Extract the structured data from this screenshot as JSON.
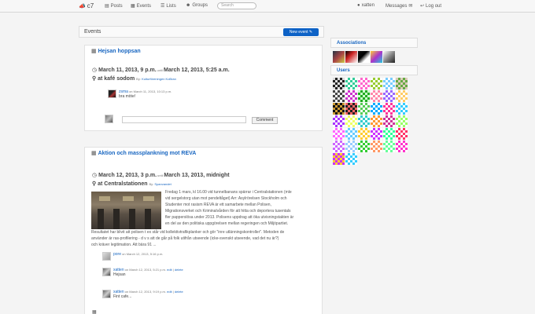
{
  "nav": {
    "brand": "c7",
    "items": [
      {
        "label": "Posts",
        "icon": "document-icon"
      },
      {
        "label": "Events",
        "icon": "calendar-icon"
      },
      {
        "label": "Lists",
        "icon": "list-icon"
      },
      {
        "label": "Groups",
        "icon": "group-icon"
      }
    ],
    "search_placeholder": "Search",
    "user": "xatten",
    "messages": "Messages",
    "logout": "Log out"
  },
  "page": {
    "title": "Events",
    "new_event_label": "New event"
  },
  "events": [
    {
      "title": "Hejsan hoppsan",
      "start": "March 11, 2013, 9 p.m.",
      "until": "until",
      "end": "March 12, 2013, 5:25 a.m.",
      "location": "at kafé sodom",
      "by_label": "By:",
      "by": "Kulturföreningen KoBran",
      "comments": [
        {
          "author": "zsma",
          "meta": "on March 11, 2013, 10:13 p.m.",
          "text": "bra möte!"
        }
      ],
      "comment_button": "Comment"
    },
    {
      "title": "Aktion och massplankning mot REVA",
      "start": "March 12, 2013, 3 p.m.",
      "until": "until",
      "end": "March 13, 2013, midnight",
      "location": "at Centralstationen",
      "by_label": "By:",
      "by": "Spanvandet",
      "description_lines": [
        "Fredag 1 mars, kl 16.00 vid tunnelbanans spärrar i Centralstationen (mle",
        "vid sergelstorg utan mot pendeltåget) Arr: Asylrörelsen Stockholm och",
        "Studenter mot rasism REVA är ett samarbete mellan Polisen,",
        "Migrationsverket och Kriminalvården för att hitta och deportera tusentals",
        "fler papperslösa under 2013. Polisens uppdrag att öka utvisningstakten är",
        "en del av den politiska uppgörelsen mellan regeringen och Miljöpartiet."
      ],
      "description_full_lines": [
        "Resultatet har blivit att polisen t ex står vid kollektivtrafikplanker och gör \"inre utlänningskontroller\". Metoden de",
        "använder är ras-profilering - d v s att de går på folk utifrån utseende (icke-svenskt utseende, vad det nu är?)",
        "och kräver legitimation. Att bära 91 ..."
      ],
      "comments": [
        {
          "author": "pore",
          "meta": "on March 12, 2013, 5:16 p.m.",
          "text": ""
        },
        {
          "author": "xatten",
          "meta": "on March 12, 2013, 5:21 p.m.",
          "edit": "edit",
          "delete": "delete",
          "text": "Hejsan"
        },
        {
          "author": "xatten",
          "meta": "on March 12, 2013, 9:19 p.m.",
          "edit": "edit",
          "delete": "delete",
          "text": "Fint cafe..."
        }
      ]
    }
  ],
  "sidebar": {
    "associations_title": "Associations",
    "users_title": "Users"
  },
  "colors": {
    "link": "#1866c1",
    "button": "#0d62c6"
  }
}
